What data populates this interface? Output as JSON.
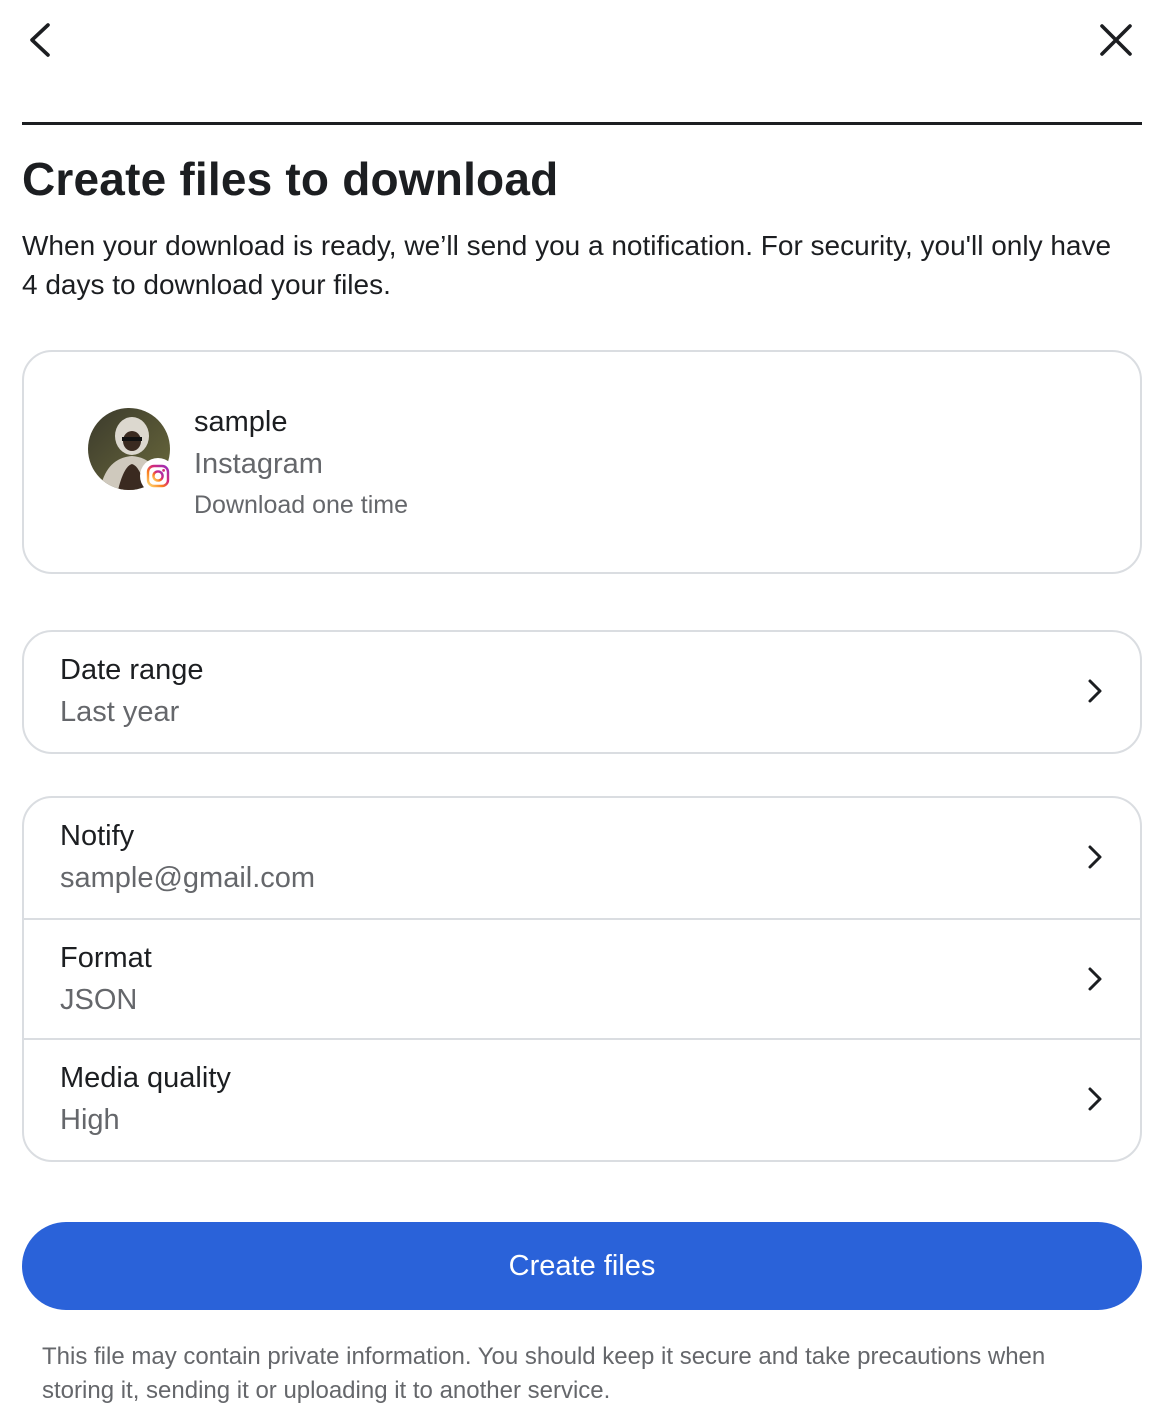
{
  "header": {
    "back_icon": "chevron-left-icon",
    "close_icon": "close-icon"
  },
  "main": {
    "title": "Create files to download",
    "description": "When your download is ready, we’ll send you a notification. For security, you'll only have 4 days to download your files."
  },
  "account": {
    "name": "sample",
    "platform": "Instagram",
    "note": "Download one time",
    "badge_icon": "instagram-icon"
  },
  "settings": {
    "date_range": {
      "label": "Date range",
      "value": "Last year"
    },
    "notify": {
      "label": "Notify",
      "value": "sample@gmail.com"
    },
    "format": {
      "label": "Format",
      "value": "JSON"
    },
    "media_quality": {
      "label": "Media quality",
      "value": "High"
    }
  },
  "actions": {
    "create_files_label": "Create files"
  },
  "footer": {
    "note": "This file may contain private information. You should keep it secure and take precautions when storing it, sending it or uploading it to another service."
  },
  "colors": {
    "primary": "#2a62d9",
    "text": "#1c1e21",
    "secondary_text": "#65676b",
    "border": "#dadde1"
  }
}
